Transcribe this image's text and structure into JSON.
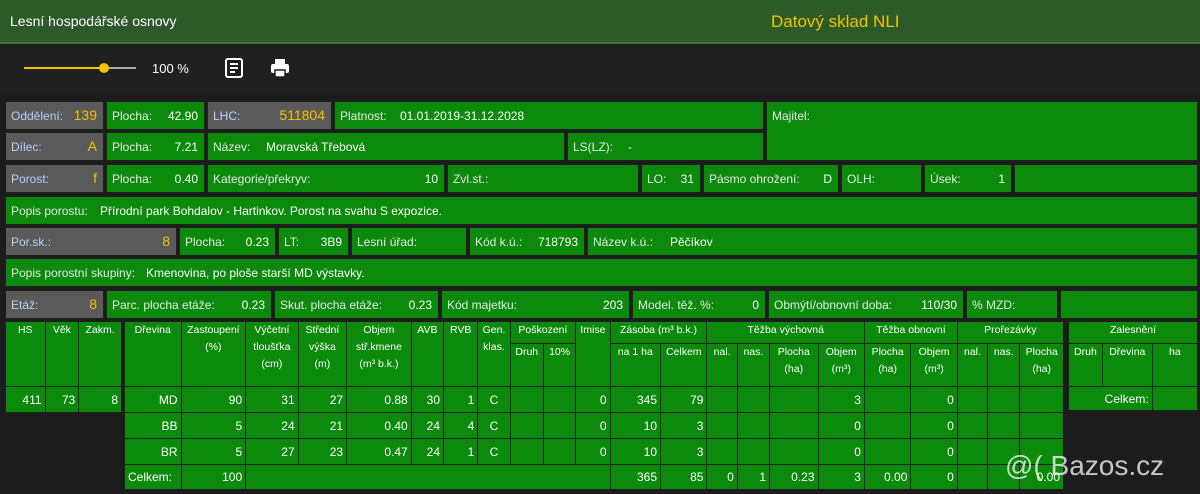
{
  "header": {
    "title": "Lesní hospodářské osnovy",
    "brand": "Datový sklad NLI"
  },
  "toolbar": {
    "zoom_value": 80,
    "zoom_label": "100 %"
  },
  "row1": {
    "oddeleni_label": "Oddělení:",
    "oddeleni_value": "139",
    "plocha_label": "Plocha:",
    "plocha_value": "42.90",
    "lhc_label": "LHC:",
    "lhc_value": "511804",
    "platnost_label": "Platnost:",
    "platnost_value": "01.01.2019-31.12.2028",
    "majitel_label": "Majitel:"
  },
  "row2": {
    "dilec_label": "Dílec:",
    "dilec_value": "A",
    "plocha_label": "Plocha:",
    "plocha_value": "7.21",
    "nazev_label": "Název:",
    "nazev_value": "Moravská Třebová",
    "ls_label": "LS(LZ):",
    "ls_value": "-"
  },
  "row3": {
    "porost_label": "Porost:",
    "porost_value": "f",
    "plocha_label": "Plocha:",
    "plocha_value": "0.40",
    "kategorie_label": "Kategorie/překryv:",
    "kategorie_value": "10",
    "zvl_label": "Zvl.st.:",
    "lo_label": "LO:",
    "lo_value": "31",
    "pasmo_label": "Pásmo ohrožení:",
    "pasmo_value": "D",
    "olh_label": "OLH:",
    "usek_label": "Úsek:",
    "usek_value": "1"
  },
  "popis_porostu": {
    "label": "Popis porostu:",
    "value": "Přírodní park Bohdalov - Hartinkov. Porost na svahu S expozice."
  },
  "row5": {
    "porsk_label": "Por.sk.:",
    "porsk_value": "8",
    "plocha_label": "Plocha:",
    "plocha_value": "0.23",
    "lt_label": "LT:",
    "lt_value": "3B9",
    "lesni_urad_label": "Lesní úřad:",
    "kod_ku_label": "Kód k.ú.:",
    "kod_ku_value": "718793",
    "nazev_ku_label": "Název k.ú.:",
    "nazev_ku_value": "Pěčíkov"
  },
  "popis_skupiny": {
    "label": "Popis porostní skupiny:",
    "value": "Kmenovina, po ploše starší MD výstavky."
  },
  "row7": {
    "etaz_label": "Etáž:",
    "etaz_value": "8",
    "parc_label": "Parc. plocha etáže:",
    "parc_value": "0.23",
    "skut_label": "Skut. plocha etáže:",
    "skut_value": "0.23",
    "kod_majetku_label": "Kód majetku:",
    "kod_majetku_value": "203",
    "model_label": "Model. těž. %:",
    "model_value": "0",
    "obmyti_label": "Obmýtí/obnovní doba:",
    "obmyti_value": "110/30",
    "mzd_label": "% MZD:"
  },
  "left_table": {
    "headers": [
      "HS",
      "Věk",
      "Zakm."
    ],
    "values": [
      "411",
      "73",
      "8"
    ]
  },
  "main_table": {
    "h": {
      "drevina": "Dřevina",
      "zastoupeni": "Zastoupení",
      "zastoupeni_unit": "(%)",
      "vycetni": "Výčetní",
      "tloustka": "tloušťka",
      "vycetni_unit": "(cm)",
      "stredni": "Střední",
      "vyska": "výška",
      "stredni_unit": "(m)",
      "objem": "Objem",
      "objem2": "stř.kmene",
      "objem_unit": "(m³ b.k.)",
      "avb": "AVB",
      "rvb": "RVB",
      "gen": "Gen.",
      "gen2": "klas.",
      "poskozeni": "Poškození",
      "druh": "Druh",
      "pct10": "10%",
      "imise": "Imise",
      "zasoba": "Zásoba (m³ b.k.)",
      "na1ha": "na 1 ha",
      "celkem": "Celkem",
      "tezba_vych": "Těžba výchovná",
      "nal": "nal.",
      "nas": "nas.",
      "plocha": "Plocha",
      "ha": "(ha)",
      "objem_short": "Objem",
      "m3": "(m³)",
      "tezba_obn": "Těžba obnovní",
      "prorezavky": "Prořezávky"
    },
    "rows": [
      [
        "MD",
        "90",
        "31",
        "27",
        "0.88",
        "30",
        "1",
        "C",
        "",
        "",
        "0",
        "345",
        "79",
        "",
        "",
        "",
        "3",
        "",
        "0",
        "",
        "",
        ""
      ],
      [
        "BB",
        "5",
        "24",
        "21",
        "0.40",
        "24",
        "4",
        "C",
        "",
        "",
        "0",
        "10",
        "3",
        "",
        "",
        "",
        "0",
        "",
        "0",
        "",
        "",
        ""
      ],
      [
        "BR",
        "5",
        "27",
        "23",
        "0.47",
        "24",
        "1",
        "C",
        "",
        "",
        "0",
        "10",
        "3",
        "",
        "",
        "",
        "0",
        "",
        "0",
        "",
        "",
        ""
      ]
    ],
    "total": {
      "label": "Celkem:",
      "zastoupeni": "100",
      "na1ha": "365",
      "celkem": "85",
      "tv_nal": "0",
      "tv_nas": "1",
      "tv_plocha": "0.23",
      "tv_objem": "3",
      "to_plocha": "0.00",
      "to_objem": "0",
      "pr_plocha": "0.00"
    }
  },
  "zalesneni": {
    "title": "Zalesnění",
    "druh": "Druh",
    "drevina": "Dřevina",
    "ha": "ha",
    "celkem": "Celkem:"
  },
  "watermark": "@( Bazos.cz"
}
